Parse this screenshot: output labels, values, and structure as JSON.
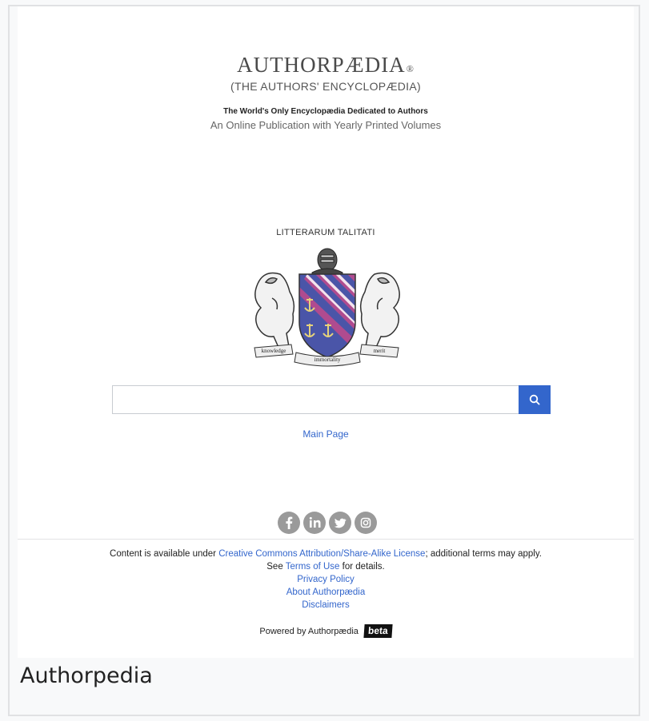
{
  "brand": {
    "title": "AUTHORPÆDIA",
    "registered": "®",
    "subtitle": "(THE AUTHORS' ENCYCLOPÆDIA)",
    "tagline": "The World's Only Encyclopædia Dedicated to Authors",
    "subline": "An Online Publication with Yearly Printed Volumes"
  },
  "crest": {
    "motto": "LITTERARUM TALITATI",
    "ribbon_left": "knowledge",
    "ribbon_center": "immortality",
    "ribbon_right": "merit",
    "colors": {
      "shield": "#4a55a8",
      "stripe": "#b04b8f"
    }
  },
  "search": {
    "placeholder": "",
    "value": "",
    "button_icon": "search-icon",
    "button_color": "#3366cc"
  },
  "nav": {
    "main_page": "Main Page"
  },
  "social": [
    "facebook-icon",
    "linkedin-icon",
    "twitter-icon",
    "instagram-icon"
  ],
  "footer": {
    "content_prefix": "Content is available under ",
    "license_link": "Creative Commons Attribution/Share-Alike License",
    "content_suffix": "; additional terms may apply.",
    "see_prefix": "See ",
    "terms_link": "Terms of Use",
    "see_suffix": " for details.",
    "privacy": "Privacy Policy",
    "about": "About Authorpædia",
    "disclaimers": "Disclaimers",
    "powered_by": "Powered by Authorpædia",
    "beta": "beta"
  },
  "caption": "Authorpedia"
}
